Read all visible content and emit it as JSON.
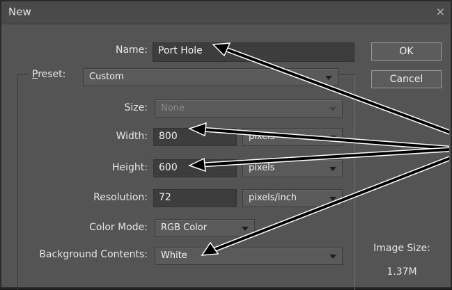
{
  "dialog": {
    "title": "New",
    "close_glyph": "×",
    "name_label": "Name:",
    "name_value": "Port Hole",
    "preset_label_underlined": "P",
    "preset_label_rest": "reset:",
    "preset_value": "Custom",
    "size_label": "Size:",
    "size_value": "None",
    "width_label": "Width:",
    "width_value": "800",
    "width_unit": "pixels",
    "height_label": "Height:",
    "height_value": "600",
    "height_unit": "pixels",
    "resolution_label": "Resolution:",
    "resolution_value": "72",
    "resolution_unit": "pixels/inch",
    "color_mode_label": "Color Mode:",
    "color_mode_value": "RGB Color",
    "background_label": "Background Contents:",
    "background_value": "White",
    "ok_label": "OK",
    "cancel_label": "Cancel",
    "image_size_label": "Image Size:",
    "image_size_value": "1.37M"
  },
  "annotation": {
    "arrow_color": "#000000",
    "arrow_outline_color": "#ffffff",
    "targets": [
      "name-field",
      "width-field",
      "height-field",
      "background-combo"
    ]
  }
}
